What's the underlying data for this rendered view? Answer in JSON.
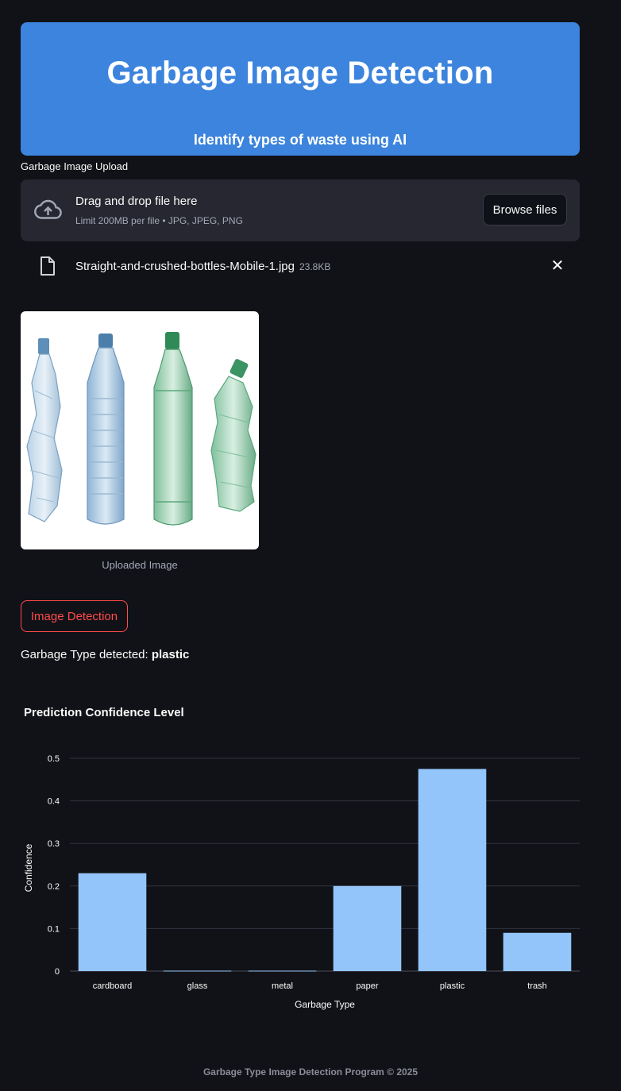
{
  "header": {
    "title": "Garbage Image Detection",
    "subtitle": "Identify types of waste using AI"
  },
  "uploader": {
    "label": "Garbage Image Upload",
    "drop_title": "Drag and drop file here",
    "limit_text": "Limit 200MB per file • JPG, JPEG, PNG",
    "browse_label": "Browse files",
    "icon": "cloud-upload-icon"
  },
  "file": {
    "name": "Straight-and-crushed-bottles-Mobile-1.jpg",
    "size": "23.8KB",
    "icon": "file-icon",
    "close_icon": "close-icon"
  },
  "image": {
    "caption": "Uploaded Image"
  },
  "detect_button": {
    "label": "Image Detection"
  },
  "result": {
    "prefix": "Garbage Type detected: ",
    "value": "plastic"
  },
  "chart_data": {
    "type": "bar",
    "title": "Prediction Confidence Level",
    "xlabel": "Garbage Type",
    "ylabel": "Confidence",
    "categories": [
      "cardboard",
      "glass",
      "metal",
      "paper",
      "plastic",
      "trash"
    ],
    "values": [
      0.23,
      0.001,
      0.001,
      0.2,
      0.475,
      0.09
    ],
    "ylim": [
      0,
      0.5
    ],
    "yticks": [
      0,
      0.1,
      0.2,
      0.3,
      0.4,
      0.5
    ],
    "ytick_labels": [
      "0",
      "0.1",
      "0.2",
      "0.3",
      "0.4",
      "0.5"
    ],
    "bar_color": "#93c5fa",
    "grid": true
  },
  "footer": {
    "text": "Garbage Type Image Detection Program © 2025"
  },
  "colors": {
    "background": "#111217",
    "header": "#3c84dd",
    "accent": "#ff4b4b",
    "dropzone": "#262730"
  }
}
